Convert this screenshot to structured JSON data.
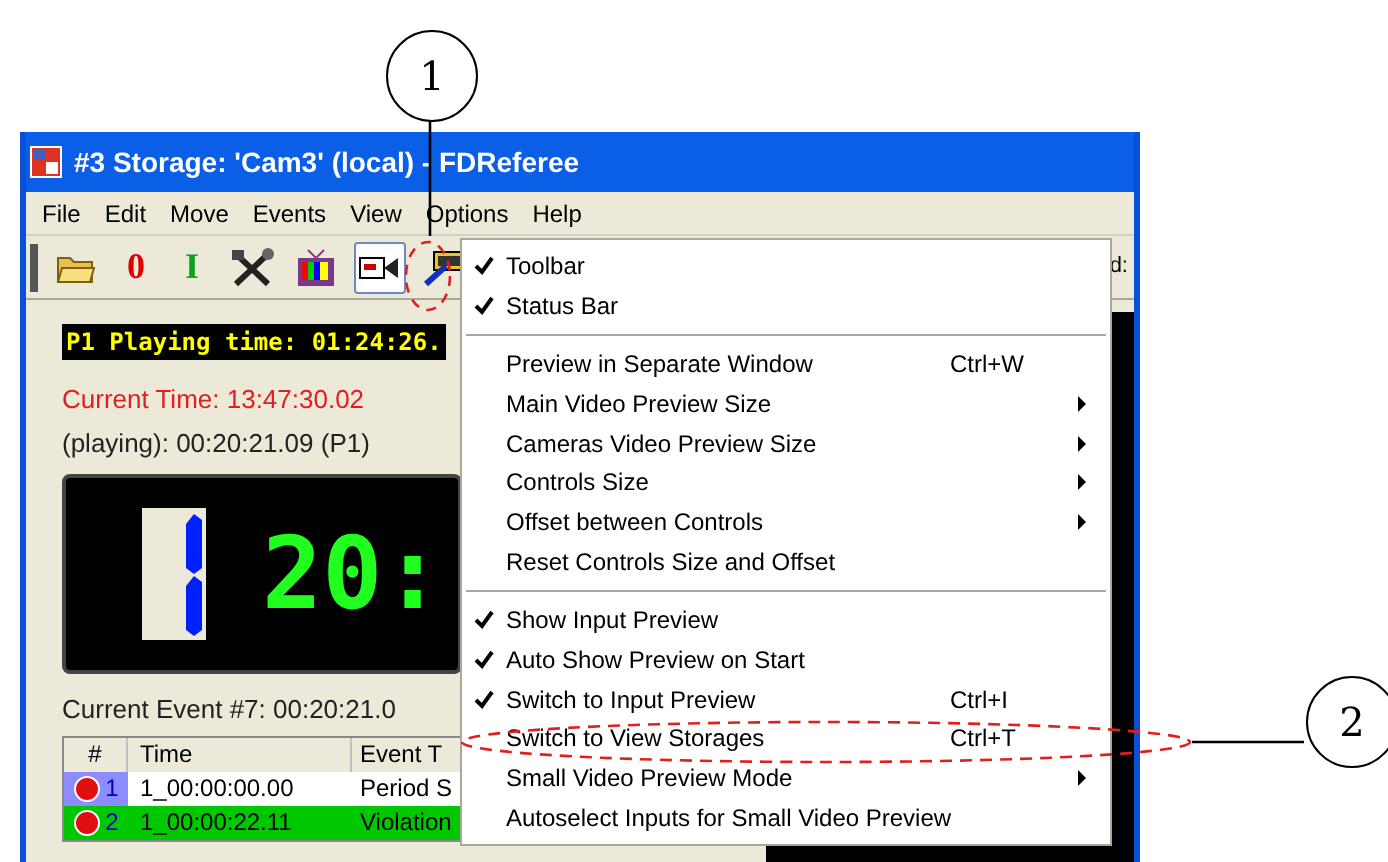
{
  "callouts": [
    {
      "label": "1"
    },
    {
      "label": "2"
    }
  ],
  "window": {
    "title": "#3 Storage: 'Cam3' (local) - FDReferee"
  },
  "menu_bar": [
    {
      "label": "File"
    },
    {
      "label": "Edit"
    },
    {
      "label": "Move"
    },
    {
      "label": "Events"
    },
    {
      "label": "View"
    },
    {
      "label": "Options"
    },
    {
      "label": "Help"
    }
  ],
  "toolbar": [
    {
      "kind": "folder"
    },
    {
      "kind": "glyph",
      "label": "0",
      "color": "#e00000"
    },
    {
      "kind": "glyph",
      "label": "I",
      "color": "#10a020"
    },
    {
      "kind": "tools"
    },
    {
      "kind": "tv"
    },
    {
      "kind": "camera",
      "pressed": true
    },
    {
      "kind": "film",
      "pressed": false
    }
  ],
  "toolbar_text": "d:",
  "playing_time": "P1 Playing time: 01:24:26.",
  "current_time": "Current Time: 13:47:30.02",
  "playing": "(playing): 00:20:21.09 (P1)",
  "clock": {
    "digits": "20:"
  },
  "current_event": "Current Event #7: 00:20:21.0",
  "events_table": {
    "columns": [
      "#",
      "Time",
      "Event T"
    ],
    "rows": [
      {
        "number": "1",
        "time": "1_00:00:00.00",
        "event": "Period S",
        "color": "#8c8cff",
        "selected": false
      },
      {
        "number": "2",
        "time": "1_00:00:22.11",
        "event": "Violation",
        "color": "#00c800",
        "selected": true
      }
    ]
  },
  "options_menu": [
    {
      "kind": "item",
      "label": "Toolbar",
      "checked": true
    },
    {
      "kind": "item",
      "label": "Status Bar",
      "checked": true
    },
    {
      "kind": "separator"
    },
    {
      "kind": "item",
      "label": "Preview in Separate Window",
      "checked": false,
      "shortcut": "Ctrl+W"
    },
    {
      "kind": "item",
      "label": "Main Video Preview Size",
      "checked": false,
      "submenu": true
    },
    {
      "kind": "item",
      "label": "Cameras Video Preview Size",
      "checked": false,
      "submenu": true
    },
    {
      "kind": "item",
      "label": "Controls Size",
      "checked": false,
      "submenu": true
    },
    {
      "kind": "item",
      "label": "Offset between Controls",
      "checked": false,
      "submenu": true
    },
    {
      "kind": "item",
      "label": "Reset Controls Size and Offset",
      "checked": false
    },
    {
      "kind": "separator"
    },
    {
      "kind": "item",
      "label": "Show Input Preview",
      "checked": true
    },
    {
      "kind": "item",
      "label": "Auto Show Preview on Start",
      "checked": true
    },
    {
      "kind": "item",
      "label": "Switch to Input Preview",
      "checked": true,
      "shortcut": "Ctrl+I"
    },
    {
      "kind": "item",
      "label": "Switch to View Storages",
      "checked": false,
      "shortcut": "Ctrl+T"
    },
    {
      "kind": "item",
      "label": "Small Video Preview Mode",
      "checked": false,
      "submenu": true
    },
    {
      "kind": "item",
      "label": "Autoselect Inputs for Small Video Preview",
      "checked": false
    }
  ]
}
